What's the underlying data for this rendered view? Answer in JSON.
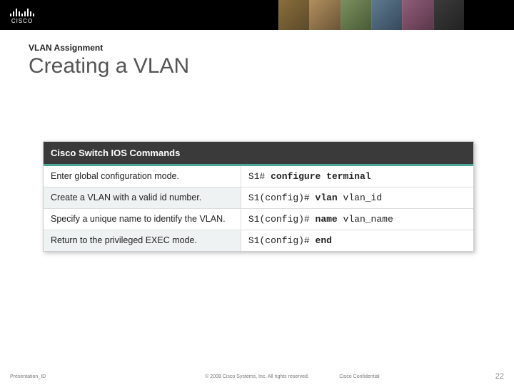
{
  "header": {
    "logo_text": "CISCO"
  },
  "content": {
    "pretitle": "VLAN Assignment",
    "title": "Creating a VLAN"
  },
  "table": {
    "header": "Cisco Switch IOS Commands",
    "rows": [
      {
        "desc": "Enter global configuration mode.",
        "prompt": "S1# ",
        "cmd": "configure terminal",
        "arg": ""
      },
      {
        "desc": "Create a VLAN with a valid id number.",
        "prompt": "S1(config)# ",
        "cmd": "vlan ",
        "arg": "vlan_id"
      },
      {
        "desc": "Specify a unique name to identify the VLAN.",
        "prompt": "S1(config)# ",
        "cmd": "name ",
        "arg": "vlan_name"
      },
      {
        "desc": "Return to the privileged EXEC mode.",
        "prompt": "S1(config)# ",
        "cmd": "end",
        "arg": ""
      }
    ]
  },
  "footer": {
    "presentation_id": "Presentation_ID",
    "copyright": "© 2008 Cisco Systems, Inc. All rights reserved.",
    "confidential": "Cisco Confidential",
    "page": "22"
  }
}
